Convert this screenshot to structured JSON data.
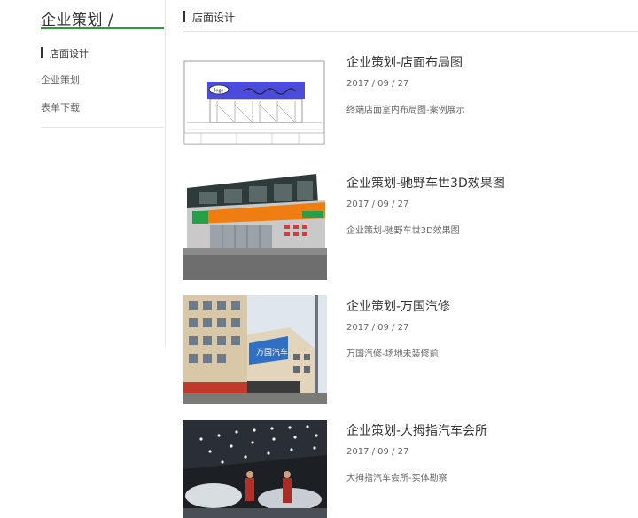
{
  "sidebar": {
    "title": "企业策划 /",
    "items": [
      {
        "label": "店面设计",
        "active": true
      },
      {
        "label": "企业策划",
        "active": false
      },
      {
        "label": "表单下载",
        "active": false
      }
    ]
  },
  "main": {
    "section_title": "店面设计",
    "articles": [
      {
        "title": "企业策划-店面布局图",
        "date": "2017 / 09 / 27",
        "desc": "终端店面室内布局图-案例展示",
        "thumb_text": "logo"
      },
      {
        "title": "企业策划-驰野车世3D效果图",
        "date": "2017 / 09 / 27",
        "desc": "企业策划-驰野车世3D效果图"
      },
      {
        "title": "企业策划-万国汽修",
        "date": "2017 / 09 / 27",
        "desc": "万国汽修-场地未装修前",
        "thumb_text": "万国汽车"
      },
      {
        "title": "企业策划-大拇指汽车会所",
        "date": "2017 / 09 / 27",
        "desc": "大拇指汽车会所-实体勘察"
      }
    ]
  },
  "colors": {
    "accent": "#2e9a3c",
    "divider": "#e6e6e6"
  }
}
